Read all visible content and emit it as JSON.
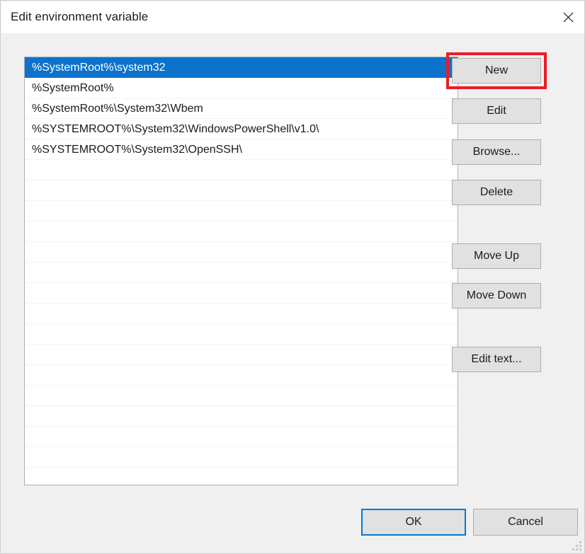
{
  "window": {
    "title": "Edit environment variable",
    "close_icon": "close-icon"
  },
  "list": {
    "rows": [
      "%SystemRoot%\\system32",
      "%SystemRoot%",
      "%SystemRoot%\\System32\\Wbem",
      "%SYSTEMROOT%\\System32\\WindowsPowerShell\\v1.0\\",
      "%SYSTEMROOT%\\System32\\OpenSSH\\"
    ],
    "selected_index": 0,
    "empty_row_count": 15
  },
  "side_buttons": {
    "new": "New",
    "edit": "Edit",
    "browse": "Browse...",
    "delete": "Delete",
    "move_up": "Move Up",
    "move_down": "Move Down",
    "edit_text": "Edit text..."
  },
  "bottom_buttons": {
    "ok": "OK",
    "cancel": "Cancel"
  },
  "annotation": {
    "target": "new-button",
    "color": "#ec1c24"
  },
  "colors": {
    "selection": "#0c72cc",
    "dialog_background": "#f0f0f0",
    "titlebar_background": "#ffffff",
    "button_face": "#e1e1e1",
    "focus_border": "#0078d7"
  }
}
